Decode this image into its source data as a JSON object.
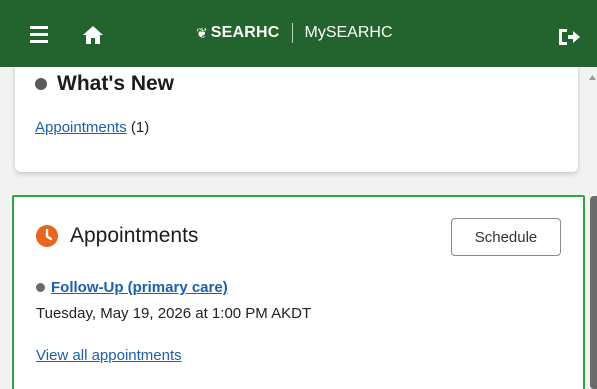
{
  "header": {
    "menu_icon": "hamburger-menu-icon",
    "home_icon": "home-icon",
    "brand_leaf": "❦",
    "org_name": "SEARHC",
    "app_name": "MySEARHC",
    "logout_icon": "logout-icon",
    "background_color": "#23632d"
  },
  "whats_new": {
    "title": "What's New",
    "link_label": "Appointments",
    "count": "(1)"
  },
  "appointments": {
    "title": "Appointments",
    "schedule_label": "Schedule",
    "accent_color": "#e8651a",
    "border_color": "#2ea63c",
    "items": [
      {
        "name": "Follow-Up (primary care)",
        "datetime": "Tuesday, May 19, 2026 at 1:00 PM AKDT"
      }
    ],
    "view_all_label": "View all appointments"
  }
}
